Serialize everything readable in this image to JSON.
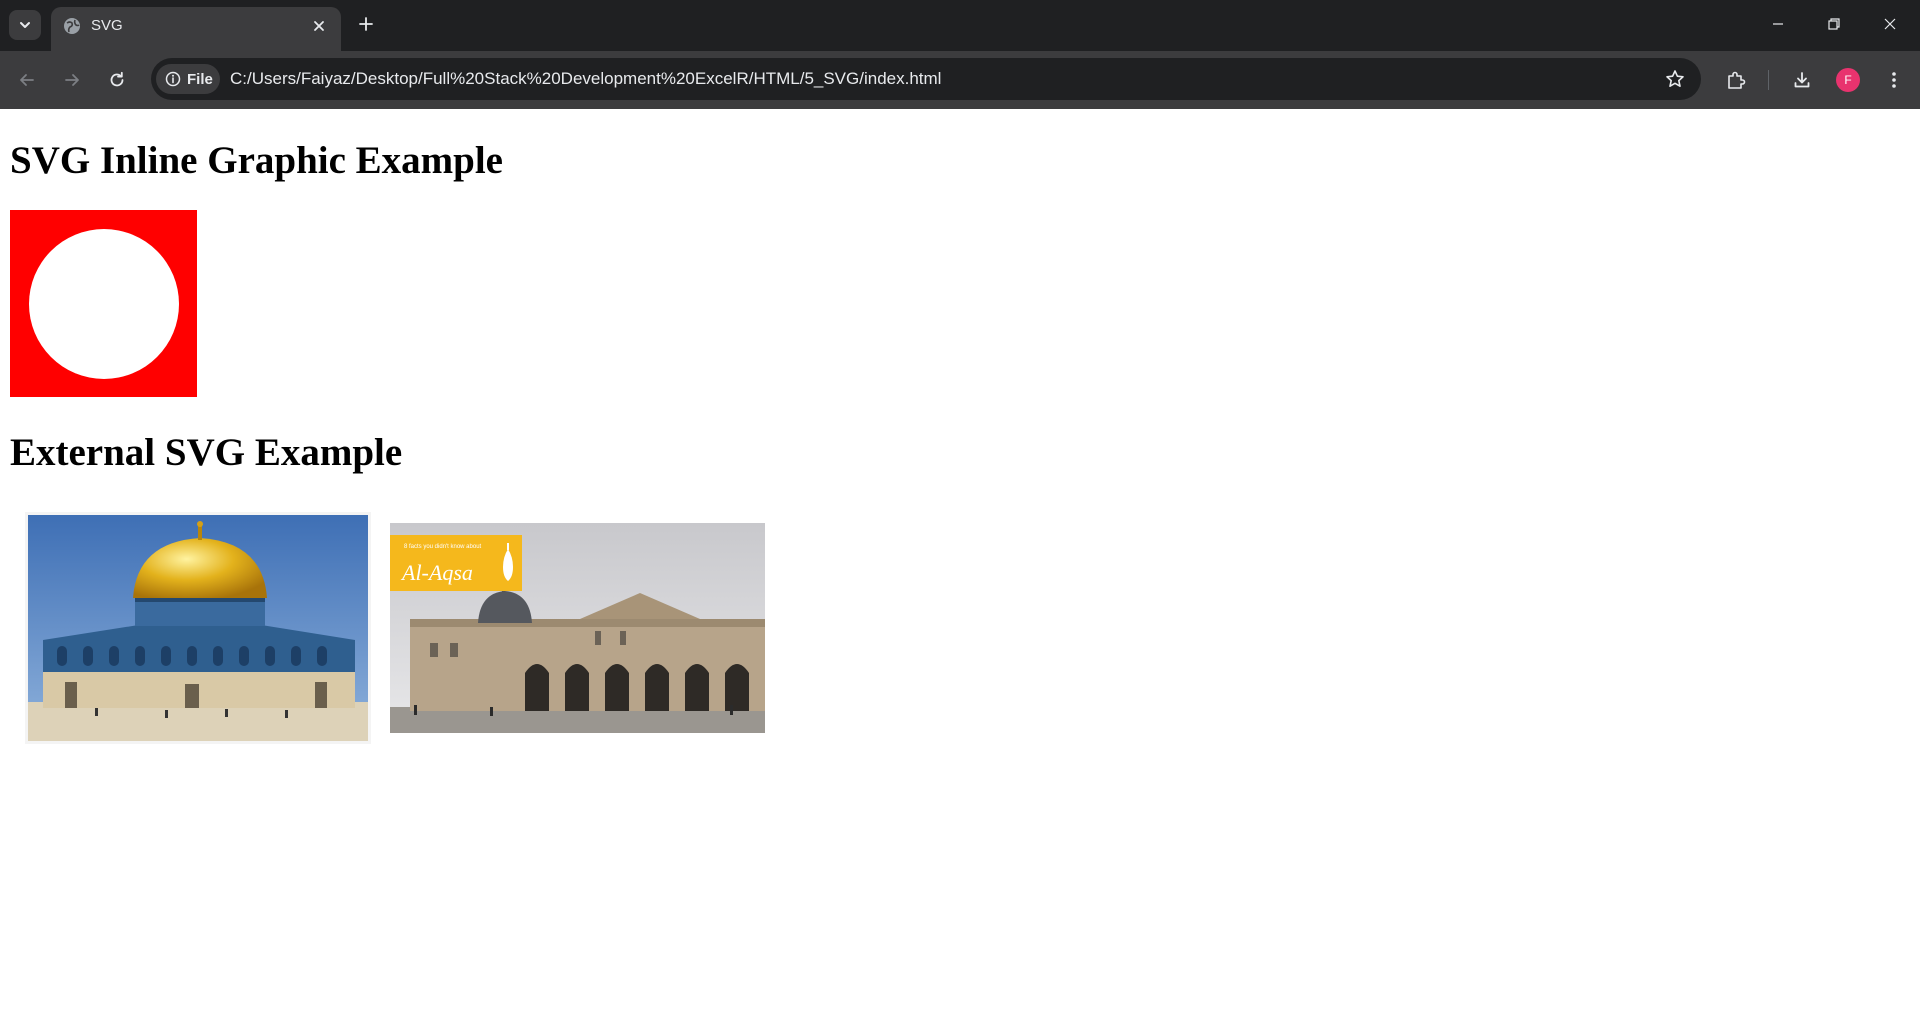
{
  "browser": {
    "tab": {
      "title": "SVG"
    },
    "address_bar": {
      "security_chip": "File",
      "url": "C:/Users/Faiyaz/Desktop/Full%20Stack%20Development%20ExcelR/HTML/5_SVG/index.html"
    },
    "profile_initial": "F",
    "colors": {
      "profile_avatar": "#e8336e",
      "frame": "#1f2022",
      "toolbar": "#3c3c3e"
    }
  },
  "page": {
    "inline_heading": "SVG Inline Graphic Example",
    "inline_graphic": {
      "rect_fill": "#ff0000",
      "circle_fill": "#ffffff"
    },
    "external_heading": "External SVG Example",
    "images": [
      {
        "name": "dome-of-the-rock-image"
      },
      {
        "name": "al-aqsa-mosque-image",
        "banner_text": "Al-Aqsa",
        "banner_small": "8 facts you didn't know about"
      }
    ]
  }
}
